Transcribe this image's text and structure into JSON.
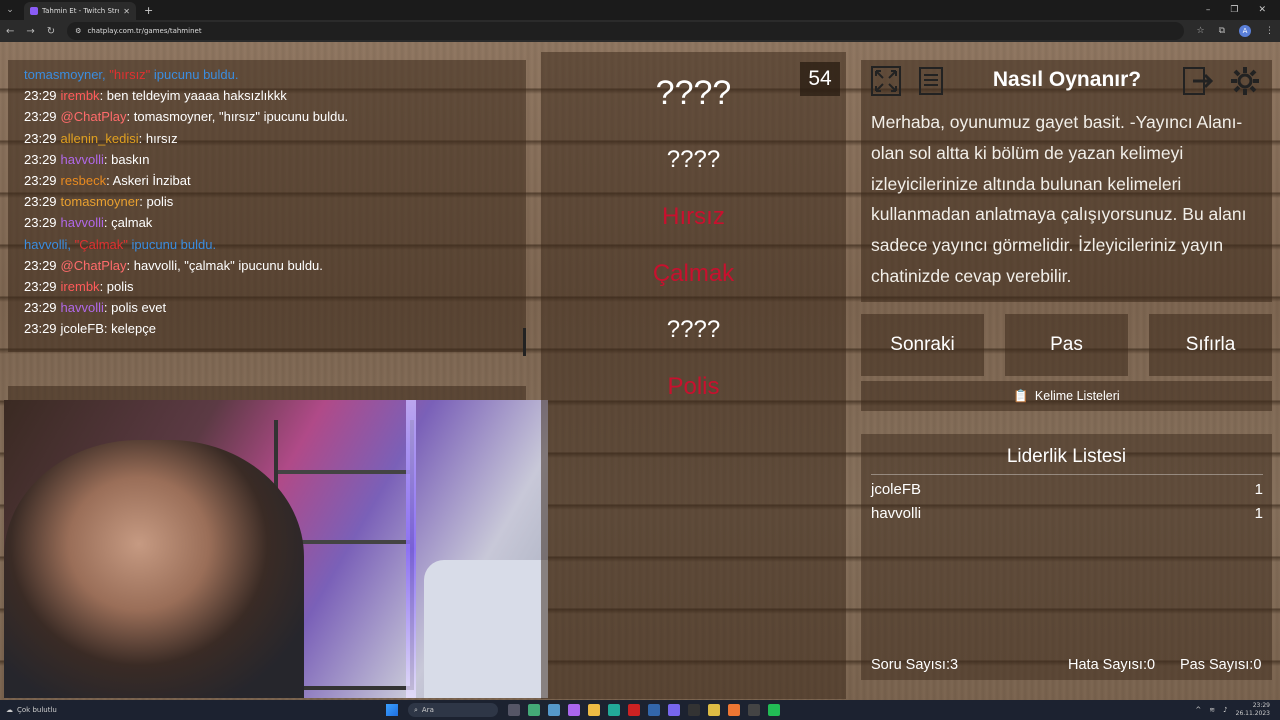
{
  "browser": {
    "tab_title": "Tahmin Et - Twitch Stream Gam",
    "url": "chatplay.com.tr/games/tahminet"
  },
  "chat": {
    "lines": [
      {
        "kind": "system",
        "user": "tomasmoyner,",
        "word": "\"hırsız\"",
        "text": "ipucunu buldu."
      },
      {
        "time": "23:29",
        "user": "irembk",
        "user_color": "#ff5a5a",
        "text": ": ben teldeyim yaaaa haksızlıkkk"
      },
      {
        "time": "23:29",
        "user": "@ChatPlay",
        "user_color": "#ff6b6b",
        "text": ": tomasmoyner, \"hırsız\" ipucunu buldu."
      },
      {
        "time": "23:29",
        "user": "allenin_kedisi",
        "user_color": "#e0a020",
        "text": ": hırsız"
      },
      {
        "time": "23:29",
        "user": "havvolli",
        "user_color": "#b068e8",
        "text": ": baskın"
      },
      {
        "time": "23:29",
        "user": "resbeck",
        "user_color": "#e88a20",
        "text": ": Askeri İnzibat"
      },
      {
        "time": "23:29",
        "user": "tomasmoyner",
        "user_color": "#e8a030",
        "text": ": polis"
      },
      {
        "time": "23:29",
        "user": "havvolli",
        "user_color": "#b068e8",
        "text": ": çalmak"
      },
      {
        "kind": "system",
        "user": "havvolli,",
        "word": "\"Çalmak\"",
        "text": "ipucunu buldu."
      },
      {
        "time": "23:29",
        "user": "@ChatPlay",
        "user_color": "#ff6b6b",
        "text": ": havvolli, \"çalmak\" ipucunu buldu."
      },
      {
        "time": "23:29",
        "user": "irembk",
        "user_color": "#ff5a5a",
        "text": ": polis"
      },
      {
        "time": "23:29",
        "user": "havvolli",
        "user_color": "#b068e8",
        "text": ": polis evet"
      },
      {
        "time": "23:29",
        "user": "jcoleFB",
        "user_color": "#ffffff",
        "text": ": kelepçe"
      }
    ]
  },
  "game": {
    "timer": "54",
    "words": [
      {
        "text": "????",
        "state": "hidden"
      },
      {
        "text": "????",
        "state": "hidden"
      },
      {
        "text": "Hırsız",
        "state": "revealed"
      },
      {
        "text": "Çalmak",
        "state": "revealed"
      },
      {
        "text": "????",
        "state": "hidden"
      },
      {
        "text": "Polis",
        "state": "revealed"
      }
    ]
  },
  "howto": {
    "title": "Nasıl Oynanır?",
    "text": "Merhaba, oyunumuz gayet basit. -Yayıncı Alanı- olan sol altta ki bölüm de yazan kelimeyi izleyicilerinize altında bulunan kelimeleri kullanmadan anlatmaya çalışıyorsunuz. Bu alanı sadece yayıncı görmelidir. İzleyicileriniz yayın chatinizde cevap verebilir."
  },
  "actions": {
    "next": "Sonraki",
    "pass": "Pas",
    "reset": "Sıfırla",
    "word_lists": "Kelime Listeleri"
  },
  "leaderboard": {
    "title": "Liderlik Listesi",
    "rows": [
      {
        "name": "jcoleFB",
        "score": "1"
      },
      {
        "name": "havvolli",
        "score": "1"
      }
    ]
  },
  "stats": {
    "questions": "Soru Sayısı:3",
    "errors": "Hata Sayısı:0",
    "passes": "Pas Sayısı:0"
  },
  "taskbar": {
    "weather": "Çok bulutlu",
    "search_placeholder": "Ara",
    "time": "23:29",
    "date": "26.11.2023"
  },
  "colors": {
    "system_blue": "#3a8de0",
    "revealed_red": "#c8102e"
  }
}
